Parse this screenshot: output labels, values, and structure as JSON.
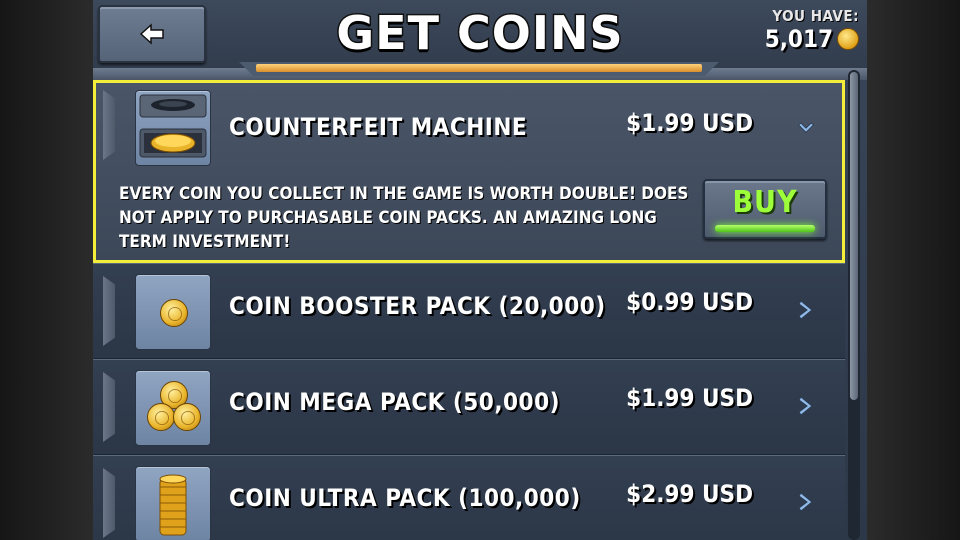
{
  "header": {
    "title": "GET COINS",
    "back_icon": "back-arrow-icon",
    "you_have_label": "YOU HAVE:",
    "balance": "5,017",
    "balance_icon": "coin-icon"
  },
  "items": [
    {
      "name": "COUNTERFEIT MACHINE",
      "price": "$1.99 USD",
      "expanded": true,
      "icon": "counterfeit-machine-icon",
      "arrow_icon": "chevron-down-icon",
      "description": "EVERY COIN YOU COLLECT IN THE GAME IS WORTH DOUBLE! DOES NOT APPLY TO PURCHASABLE COIN PACKS. AN AMAZING LONG TERM INVESTMENT!",
      "buy_label": "BUY"
    },
    {
      "name": "COIN BOOSTER PACK (20,000)",
      "price": "$0.99 USD",
      "icon": "single-coin-icon",
      "arrow_icon": "chevron-right-icon"
    },
    {
      "name": "COIN MEGA PACK (50,000)",
      "price": "$1.99 USD",
      "icon": "coin-pile-icon",
      "arrow_icon": "chevron-right-icon"
    },
    {
      "name": "COIN ULTRA PACK (100,000)",
      "price": "$2.99 USD",
      "icon": "coin-stack-icon",
      "arrow_icon": "chevron-right-icon"
    }
  ],
  "colors": {
    "selected_border": "#f2ee3a",
    "buy_text": "#9dff3a",
    "header_glow": "#f0b040"
  }
}
